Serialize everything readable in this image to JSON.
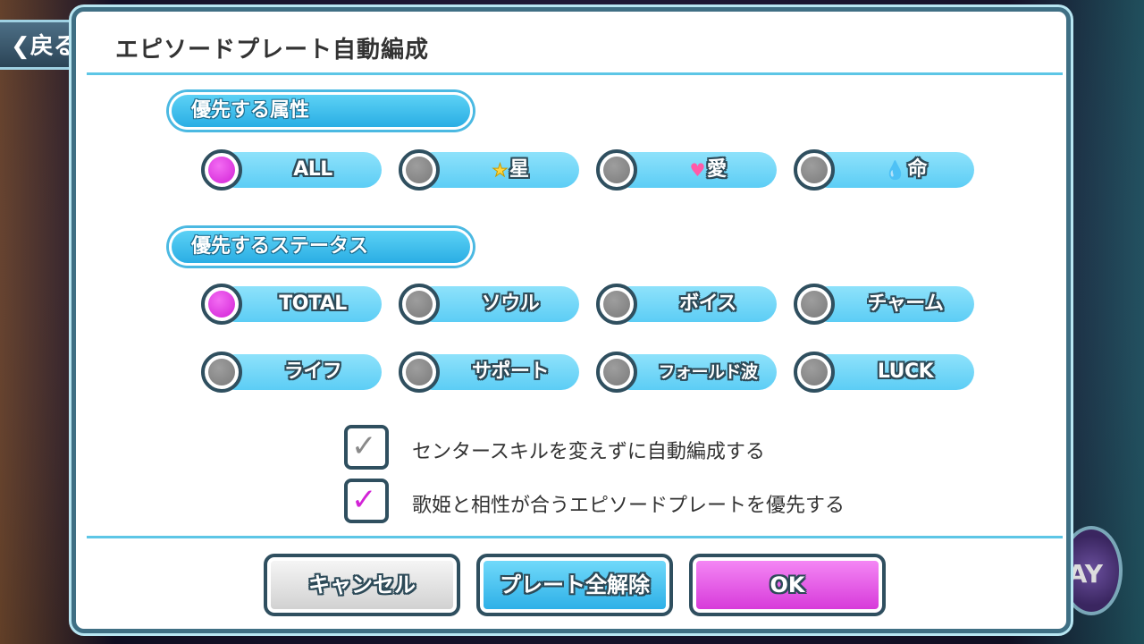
{
  "back_button": {
    "label": "❮戻る"
  },
  "day_badge": {
    "label": "AY"
  },
  "modal": {
    "title": "エピソードプレート自動編成"
  },
  "attribute_section": {
    "header": "優先する属性",
    "options": [
      {
        "label": "ALL",
        "icon": "",
        "selected": true
      },
      {
        "label": "星",
        "icon": "★",
        "selected": false
      },
      {
        "label": "愛",
        "icon": "♥",
        "selected": false
      },
      {
        "label": "命",
        "icon": "💧",
        "selected": false
      }
    ]
  },
  "status_section": {
    "header": "優先するステータス",
    "options": [
      {
        "label": "TOTAL",
        "selected": true
      },
      {
        "label": "ソウル",
        "selected": false
      },
      {
        "label": "ボイス",
        "selected": false
      },
      {
        "label": "チャーム",
        "selected": false
      },
      {
        "label": "ライフ",
        "selected": false
      },
      {
        "label": "サポート",
        "selected": false
      },
      {
        "label": "フォールド波",
        "selected": false
      },
      {
        "label": "LUCK",
        "selected": false
      }
    ]
  },
  "checkboxes": [
    {
      "label": "センタースキルを変えずに自動編成する",
      "checked": false
    },
    {
      "label": "歌姫と相性が合うエピソードプレートを優先する",
      "checked": true
    }
  ],
  "buttons": {
    "cancel": "キャンセル",
    "clear_all": "プレート全解除",
    "ok": "OK"
  },
  "colors": {
    "accent_pink": "#d223d6",
    "accent_blue": "#2aaee4",
    "border": "#2f4f5f"
  }
}
